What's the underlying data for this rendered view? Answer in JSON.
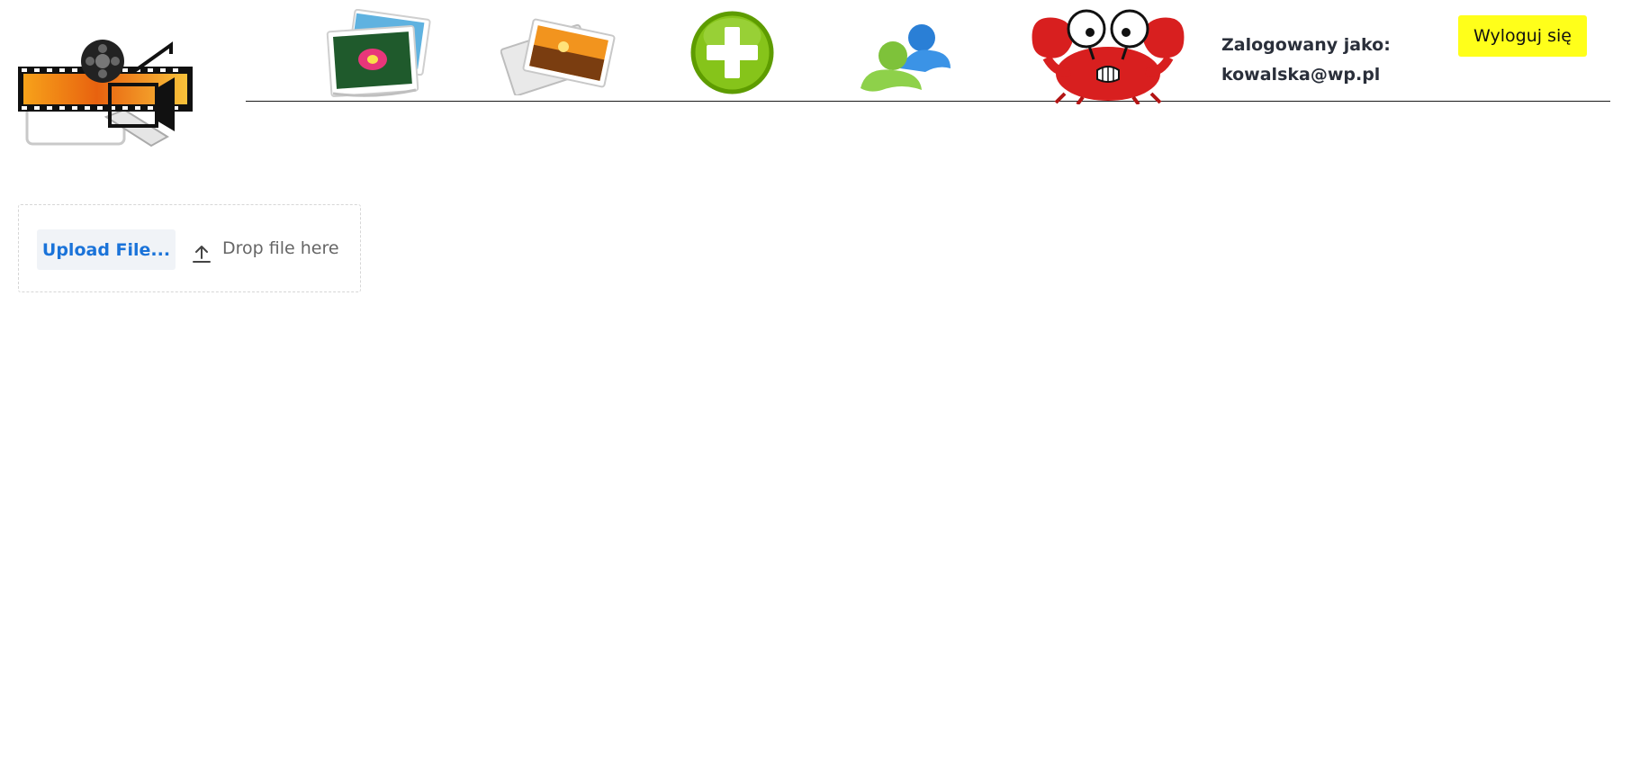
{
  "header": {
    "logo_icon": "film-projector-logo-icon",
    "nav": [
      {
        "icon": "photos-stack-icon"
      },
      {
        "icon": "photo-gallery-icon"
      },
      {
        "icon": "add-plus-icon"
      },
      {
        "icon": "users-icon"
      },
      {
        "icon": "crab-icon"
      }
    ],
    "login_label": "Zalogowany jako:",
    "login_user": "kowalska@wp.pl",
    "logout_label": "Wyloguj się"
  },
  "upload": {
    "button_label": "Upload File...",
    "drop_label": "Drop file here",
    "drop_icon": "upload-icon"
  },
  "colors": {
    "logout_bg": "#ffff1a",
    "upload_link": "#1a73d9",
    "add_green": "#7cc20f",
    "crab_red": "#d81f1f"
  }
}
